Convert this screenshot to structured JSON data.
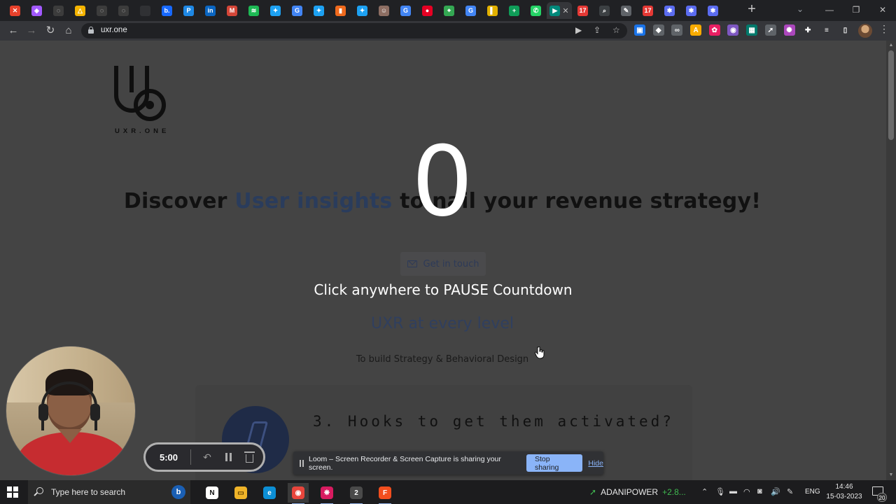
{
  "browser": {
    "tabs": [
      {
        "icon": "x-favicon-icon",
        "color": "#e8412b",
        "glyph": "✕"
      },
      {
        "icon": "figma-favicon-icon",
        "color": "#a259ff",
        "glyph": "◈"
      },
      {
        "icon": "loading-favicon-icon",
        "color": "#3c3c3c",
        "glyph": "◌"
      },
      {
        "icon": "drive-favicon-icon",
        "color": "#f4b400",
        "glyph": "△"
      },
      {
        "icon": "loading-favicon-icon",
        "color": "#3c3c3c",
        "glyph": "◌"
      },
      {
        "icon": "loading-favicon-icon",
        "color": "#3c3c3c",
        "glyph": "◌"
      },
      {
        "icon": "blank-favicon-icon",
        "color": "#303134",
        "glyph": ""
      },
      {
        "icon": "behance-favicon-icon",
        "color": "#1769ff",
        "glyph": "b."
      },
      {
        "icon": "paypal-favicon-icon",
        "color": "#1e88e5",
        "glyph": "P"
      },
      {
        "icon": "linkedin-favicon-icon",
        "color": "#0a66c2",
        "glyph": "in"
      },
      {
        "icon": "gmail-favicon-icon",
        "color": "#d44638",
        "glyph": "M"
      },
      {
        "icon": "spotify-favicon-icon",
        "color": "#1db954",
        "glyph": "≋"
      },
      {
        "icon": "twitter-favicon-icon",
        "color": "#1da1f2",
        "glyph": "✦"
      },
      {
        "icon": "google-favicon-icon",
        "color": "#4285f4",
        "glyph": "G"
      },
      {
        "icon": "twitter-favicon-icon",
        "color": "#1da1f2",
        "glyph": "✦"
      },
      {
        "icon": "bookmark-favicon-icon",
        "color": "#f06a1d",
        "glyph": "▮"
      },
      {
        "icon": "twitter-favicon-icon",
        "color": "#1da1f2",
        "glyph": "✦"
      },
      {
        "icon": "profile-favicon-icon",
        "color": "#8d6e63",
        "glyph": "☺"
      },
      {
        "icon": "google-favicon-icon",
        "color": "#4285f4",
        "glyph": "G"
      },
      {
        "icon": "pinterest-favicon-icon",
        "color": "#e60023",
        "glyph": "●"
      },
      {
        "icon": "maps-favicon-icon",
        "color": "#34a853",
        "glyph": "⌖"
      },
      {
        "icon": "google-favicon-icon",
        "color": "#4285f4",
        "glyph": "G"
      },
      {
        "icon": "yellow-favicon-icon",
        "color": "#e2b100",
        "glyph": "▌"
      },
      {
        "icon": "sheets-favicon-icon",
        "color": "#0f9d58",
        "glyph": "+"
      },
      {
        "icon": "whatsapp-favicon-icon",
        "color": "#25d366",
        "glyph": "✆"
      },
      {
        "icon": "meet-favicon-icon",
        "color": "#00897b",
        "glyph": "▶"
      },
      {
        "icon": "calendar-favicon-icon",
        "color": "#e53935",
        "glyph": "17"
      },
      {
        "icon": "search-favicon-icon",
        "color": "#3c4043",
        "glyph": "⌕"
      },
      {
        "icon": "tool-favicon-icon",
        "color": "#5f6368",
        "glyph": "✎"
      },
      {
        "icon": "calendar-favicon-icon",
        "color": "#e53935",
        "glyph": "17"
      },
      {
        "icon": "gear-favicon-icon",
        "color": "#5b6cf0",
        "glyph": "✱"
      },
      {
        "icon": "gear-favicon-icon",
        "color": "#5b6cf0",
        "glyph": "✱"
      },
      {
        "icon": "gear-favicon-icon",
        "color": "#5b6cf0",
        "glyph": "✱"
      }
    ],
    "url": "uxr.one",
    "extensions": [
      {
        "icon": "extension-1-icon",
        "color": "#1a73e8",
        "glyph": "▣"
      },
      {
        "icon": "extension-2-icon",
        "color": "#5f6368",
        "glyph": "◆"
      },
      {
        "icon": "extension-3-icon",
        "color": "#5f6368",
        "glyph": "∞"
      },
      {
        "icon": "extension-4-icon",
        "color": "#f9ab00",
        "glyph": "A"
      },
      {
        "icon": "extension-5-icon",
        "color": "#e91e63",
        "glyph": "✿"
      },
      {
        "icon": "extension-6-icon",
        "color": "#7e57c2",
        "glyph": "◉"
      },
      {
        "icon": "extension-7-icon",
        "color": "#00796b",
        "glyph": "▦"
      },
      {
        "icon": "extension-8-icon",
        "color": "#5f6368",
        "glyph": "➚"
      },
      {
        "icon": "extension-9-icon",
        "color": "#ab47bc",
        "glyph": "✺"
      },
      {
        "icon": "extensions-puzzle-icon",
        "color": "#35363a",
        "glyph": "✚"
      },
      {
        "icon": "reading-list-icon",
        "color": "#35363a",
        "glyph": "≡"
      },
      {
        "icon": "side-panel-icon",
        "color": "#35363a",
        "glyph": "▯"
      }
    ]
  },
  "page": {
    "logo_text": "UXR.ONE",
    "headline_pre": "Discover ",
    "headline_highlight": "User insights",
    "headline_post": " to nail your revenue strategy!",
    "cta_label": "Get in touch",
    "countdown_number": "0",
    "countdown_message": "Click anywhere to PAUSE Countdown",
    "subheading": "UXR at every level",
    "subtext": "To build Strategy & Behavioral Design",
    "card_title": "3. Hooks to get them activated?"
  },
  "loom": {
    "time": "5:00",
    "share_text": "Loom – Screen Recorder & Screen Capture is sharing your screen.",
    "stop_label": "Stop sharing",
    "hide_label": "Hide"
  },
  "taskbar": {
    "search_placeholder": "Type here to search",
    "apps": [
      {
        "icon": "notion-icon",
        "color": "#ffffff",
        "glyph": "N",
        "text": "#111"
      },
      {
        "icon": "file-explorer-icon",
        "color": "#f0b429",
        "glyph": "▭",
        "text": "#5a3b00"
      },
      {
        "icon": "edge-icon",
        "color": "#0c8fd6",
        "glyph": "e",
        "text": "#fff"
      },
      {
        "icon": "chrome-icon",
        "color": "#e8453c",
        "glyph": "◉",
        "text": "#fff"
      },
      {
        "icon": "chat-app-icon",
        "color": "#d81b60",
        "glyph": "❋",
        "text": "#fff"
      },
      {
        "icon": "chrome-profile-icon",
        "color": "#4a4a4a",
        "glyph": "2",
        "text": "#fff"
      },
      {
        "icon": "figma-icon",
        "color": "#f24e1e",
        "glyph": "F",
        "text": "#fff"
      }
    ],
    "stock_name": "ADANIPOWER",
    "stock_value": "+2.8...",
    "language": "ENG",
    "time": "14:46",
    "date": "15-03-2023",
    "notification_count": "20"
  }
}
